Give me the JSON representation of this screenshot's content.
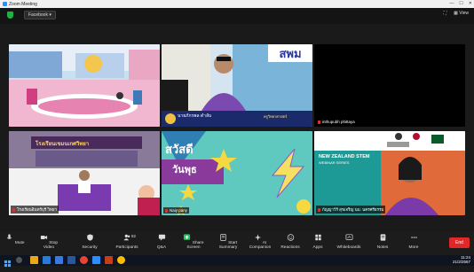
{
  "window": {
    "title": "Zoom Meeting",
    "min": "—",
    "max": "☐",
    "close": "✕"
  },
  "topbar": {
    "facebook_label": "Facebook",
    "view_label": "View"
  },
  "tiles": [
    {
      "name": "",
      "muted": false
    },
    {
      "name": "",
      "muted": false,
      "nameplate": "นายภักรพล ดำลับ",
      "nameplate_sub": "ครูวิทยาศาสตร์"
    },
    {
      "name": "inthupubh phittaya",
      "muted": true
    },
    {
      "name": "โรงเรียนอินทร์บุรี วิทยา",
      "muted": true,
      "banner": "โรงเรียนเขมนเกศวิทยา"
    },
    {
      "name": "Naiy pany",
      "muted": true,
      "greet1": "สวัสดี",
      "greet2": "วันพุธ"
    },
    {
      "name": "กัญญาวีร์ สุขเจริญ นม. นครศรีธรรม",
      "muted": true,
      "webinar_title": "NEW ZEALAND STEM",
      "webinar_sub": "WEBINAR SERIES"
    }
  ],
  "toolbar": {
    "mute": "Mute",
    "stop_video": "Stop Video",
    "security": "Security",
    "participants": "Participants",
    "participants_count": "82",
    "qa": "Q&A",
    "share_screen": "Share Screen",
    "start_summary": "Start Summary",
    "ai_companion": "AI Companion",
    "reactions": "Reactions",
    "apps": "Apps",
    "whiteboards": "Whiteboards",
    "notes": "Notes",
    "more": "More",
    "end": "End"
  },
  "clock": {
    "time": "11:24",
    "date": "21/2/2567"
  }
}
